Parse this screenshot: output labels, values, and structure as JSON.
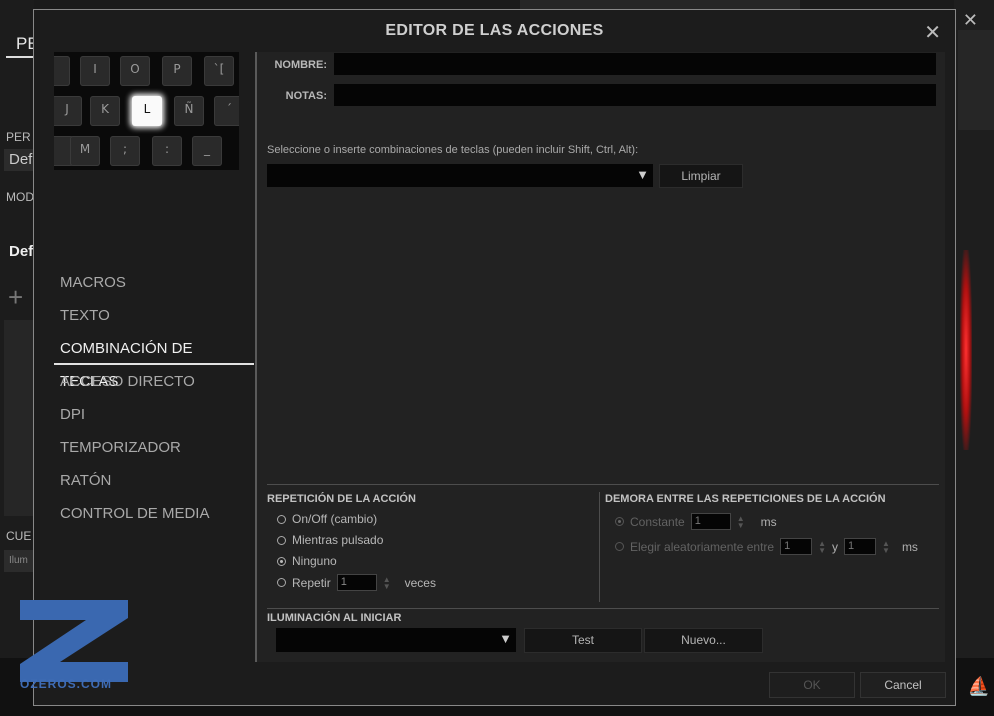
{
  "background": {
    "tab_label": "PE",
    "labels": {
      "perfil": "PER",
      "perfil_value": "Def",
      "modo": "MOD",
      "modo_value": "Def",
      "cue": "CUE",
      "ilum": "Ilum"
    },
    "watermark": "OZEROS.COM",
    "colors": {
      "glow": "#ff3030",
      "watermark": "#3a68b0"
    }
  },
  "modal": {
    "title": "EDITOR DE LAS ACCIONES",
    "close_icon": "close-icon"
  },
  "keyboard_preview": {
    "rows": [
      [
        "",
        "I",
        "O",
        "P",
        "`["
      ],
      [
        "J",
        "K",
        "L",
        "Ñ",
        "´"
      ],
      [
        "",
        "M",
        ";",
        ":",
        "_"
      ]
    ],
    "highlighted": "L"
  },
  "menu": {
    "items": [
      {
        "label": "MACROS"
      },
      {
        "label": "TEXTO"
      },
      {
        "label": "COMBINACIÓN DE TECLAS"
      },
      {
        "label": "ACCESO DIRECTO"
      },
      {
        "label": "DPI"
      },
      {
        "label": "TEMPORIZADOR"
      },
      {
        "label": "RATÓN"
      },
      {
        "label": "CONTROL DE MEDIA"
      }
    ],
    "active_index": 2
  },
  "form": {
    "name_label": "NOMBRE:",
    "name_value": "",
    "notes_label": "NOTAS:",
    "notes_value": "",
    "instructions": "Seleccione o inserte combinaciones de teclas (pueden incluir Shift, Ctrl, Alt):",
    "combo_value": "",
    "clear_button": "Limpiar"
  },
  "repeat": {
    "title": "REPETICIÓN DE LA ACCIÓN",
    "options": [
      {
        "label": "On/Off (cambio)",
        "checked": false
      },
      {
        "label": "Mientras pulsado",
        "checked": false
      },
      {
        "label": "Ninguno",
        "checked": true
      },
      {
        "label": "Repetir",
        "checked": false
      }
    ],
    "repeat_count": "1",
    "repeat_unit": "veces"
  },
  "delay": {
    "title": "DEMORA ENTRE LAS REPETICIONES DE LA ACCIÓN",
    "constant_label": "Constante",
    "constant_value": "1",
    "unit": "ms",
    "random_label": "Elegir aleatoriamente entre",
    "random_min": "1",
    "and_label": "y",
    "random_max": "1",
    "random_unit": "ms"
  },
  "lighting": {
    "title": "ILUMINACIÓN AL INICIAR",
    "select_value": "",
    "test_button": "Test",
    "new_button": "Nuevo..."
  },
  "footer": {
    "ok_button": "OK",
    "cancel_button": "Cancel"
  }
}
